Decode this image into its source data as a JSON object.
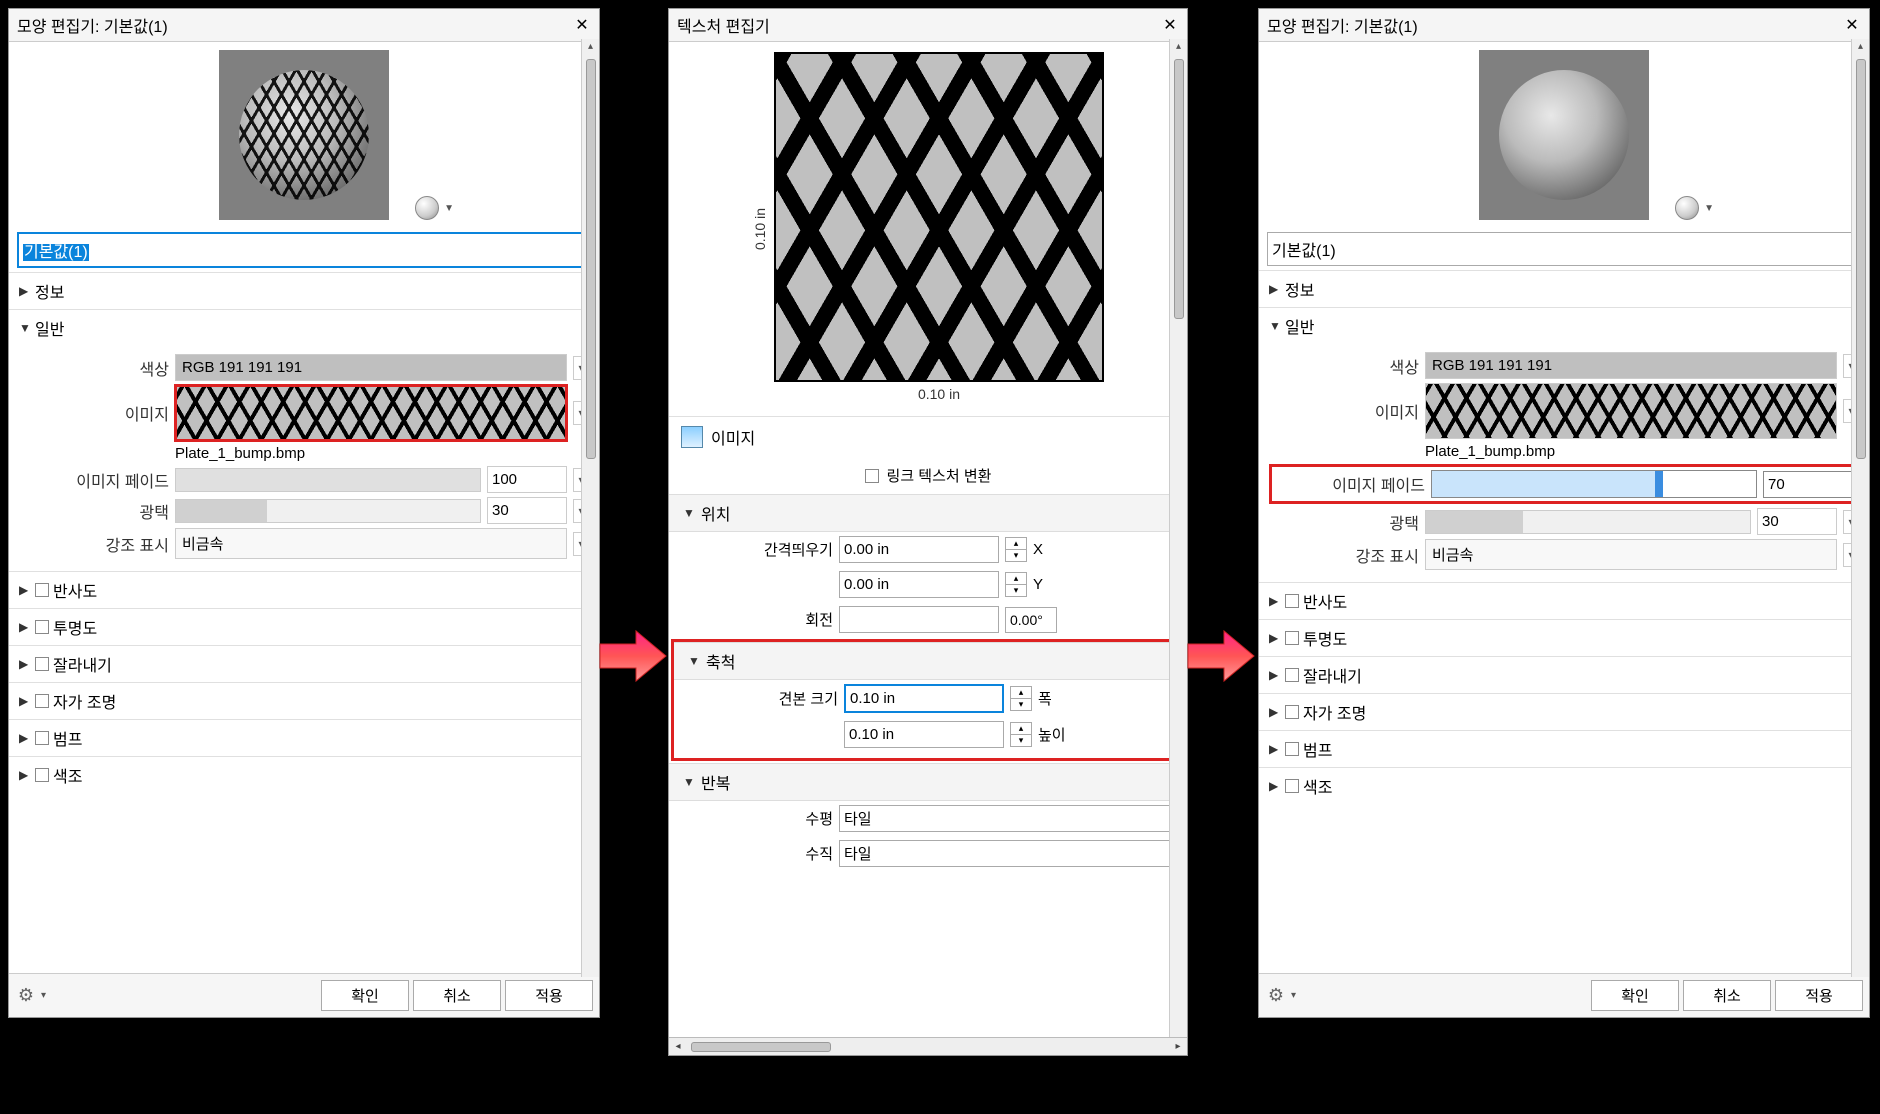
{
  "panel1": {
    "title": "모양 편집기: 기본값(1)",
    "name_value": "기본값(1)",
    "sections": {
      "info": "정보",
      "general": "일반",
      "reflect": "반사도",
      "trans": "투명도",
      "cut": "잘라내기",
      "self": "자가 조명",
      "bump": "범프",
      "tint": "색조"
    },
    "color_label": "색상",
    "color_value": "RGB 191 191 191",
    "image_label": "이미지",
    "image_name": "Plate_1_bump.bmp",
    "fade_label": "이미지 페이드",
    "fade_value": "100",
    "gloss_label": "광택",
    "gloss_value": "30",
    "highlight_label": "강조 표시",
    "highlight_value": "비금속",
    "buttons": {
      "ok": "확인",
      "cancel": "취소",
      "apply": "적용"
    }
  },
  "panel2": {
    "title": "텍스처 편집기",
    "dim_h": "0.10 in",
    "dim_v": "0.10 in",
    "image_hdr": "이미지",
    "link_label": "링크 텍스처 변환",
    "pos_hdr": "위치",
    "offset_label": "간격띄우기",
    "offset_x": "0.00 in",
    "offset_y": "0.00 in",
    "x_suf": "X",
    "y_suf": "Y",
    "rot_label": "회전",
    "rot_value": "",
    "rot_deg": "0.00°",
    "scale_hdr": "축척",
    "sample_label": "견본 크기",
    "sample_w": "0.10 in",
    "sample_h": "0.10 in",
    "w_suf": "폭",
    "h_suf": "높이",
    "repeat_hdr": "반복",
    "horiz_label": "수평",
    "horiz_val": "타일",
    "vert_label": "수직",
    "vert_val": "타일"
  },
  "panel3": {
    "title": "모양 편집기: 기본값(1)",
    "name_value": "기본값(1)",
    "sections": {
      "info": "정보",
      "general": "일반",
      "reflect": "반사도",
      "trans": "투명도",
      "cut": "잘라내기",
      "self": "자가 조명",
      "bump": "범프",
      "tint": "색조"
    },
    "color_label": "색상",
    "color_value": "RGB 191 191 191",
    "image_label": "이미지",
    "image_name": "Plate_1_bump.bmp",
    "fade_label": "이미지 페이드",
    "fade_value": "70",
    "gloss_label": "광택",
    "gloss_value": "30",
    "highlight_label": "강조 표시",
    "highlight_value": "비금속",
    "buttons": {
      "ok": "확인",
      "cancel": "취소",
      "apply": "적용"
    }
  }
}
